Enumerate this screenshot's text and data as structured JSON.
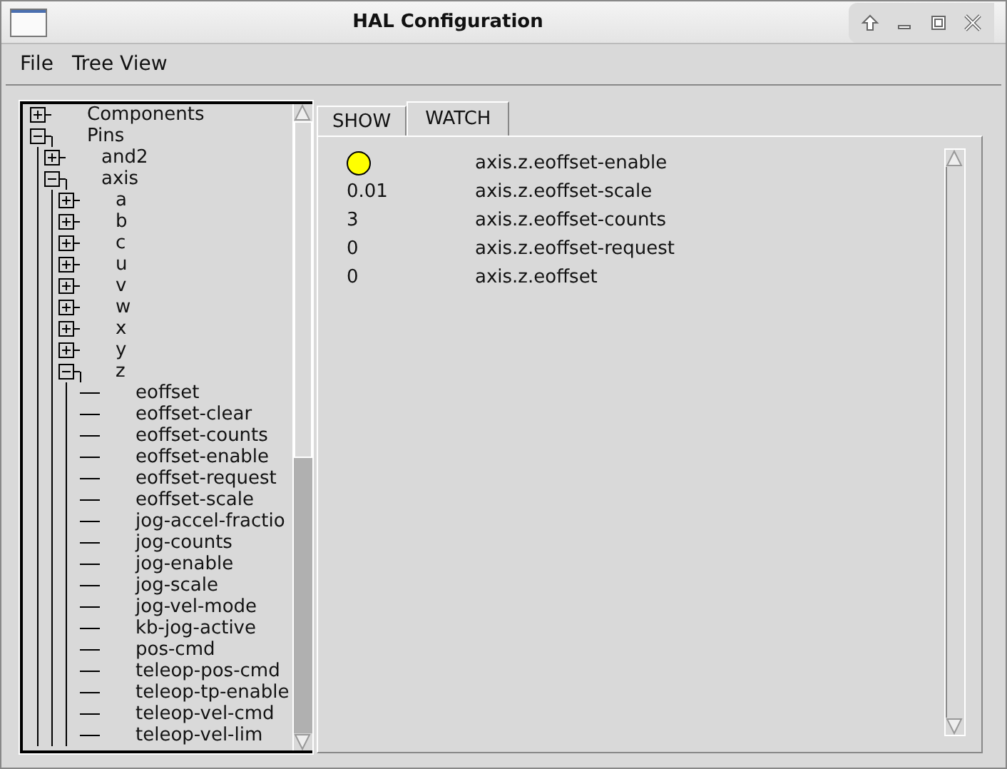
{
  "window": {
    "title": "HAL Configuration"
  },
  "menu": [
    "File",
    "Tree View"
  ],
  "tree": [
    {
      "label": "Components",
      "expanded": false
    },
    {
      "label": "Pins",
      "expanded": true,
      "children": [
        {
          "label": "and2",
          "expanded": false
        },
        {
          "label": "axis",
          "expanded": true,
          "children": [
            {
              "label": "a",
              "expanded": false
            },
            {
              "label": "b",
              "expanded": false
            },
            {
              "label": "c",
              "expanded": false
            },
            {
              "label": "u",
              "expanded": false
            },
            {
              "label": "v",
              "expanded": false
            },
            {
              "label": "w",
              "expanded": false
            },
            {
              "label": "x",
              "expanded": false
            },
            {
              "label": "y",
              "expanded": false
            },
            {
              "label": "z",
              "expanded": true,
              "children": [
                {
                  "label": "eoffset"
                },
                {
                  "label": "eoffset-clear"
                },
                {
                  "label": "eoffset-counts"
                },
                {
                  "label": "eoffset-enable"
                },
                {
                  "label": "eoffset-request"
                },
                {
                  "label": "eoffset-scale"
                },
                {
                  "label": "jog-accel-fractio"
                },
                {
                  "label": "jog-counts"
                },
                {
                  "label": "jog-enable"
                },
                {
                  "label": "jog-scale"
                },
                {
                  "label": "jog-vel-mode"
                },
                {
                  "label": "kb-jog-active"
                },
                {
                  "label": "pos-cmd"
                },
                {
                  "label": "teleop-pos-cmd"
                },
                {
                  "label": "teleop-tp-enable"
                },
                {
                  "label": "teleop-vel-cmd"
                },
                {
                  "label": "teleop-vel-lim"
                }
              ]
            }
          ]
        }
      ]
    }
  ],
  "tabs": [
    {
      "label": "SHOW",
      "selected": false
    },
    {
      "label": "WATCH",
      "selected": true
    }
  ],
  "watch": [
    {
      "kind": "led",
      "on": true,
      "name": "axis.z.eoffset-enable"
    },
    {
      "kind": "value",
      "value": "0.01",
      "name": "axis.z.eoffset-scale"
    },
    {
      "kind": "value",
      "value": "3",
      "name": "axis.z.eoffset-counts"
    },
    {
      "kind": "value",
      "value": "0",
      "name": "axis.z.eoffset-request"
    },
    {
      "kind": "value",
      "value": "0",
      "name": "axis.z.eoffset"
    }
  ]
}
